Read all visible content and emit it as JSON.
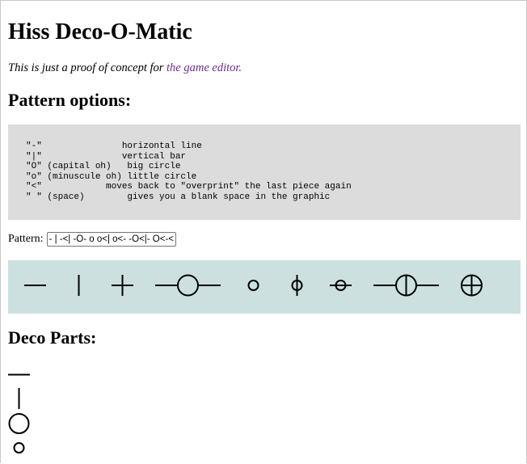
{
  "page": {
    "title": "Hiss Deco-O-Matic",
    "intro_text": "This is just a proof of concept for ",
    "intro_link": "the game editor.",
    "options_heading": "Pattern options:",
    "parts_heading": "Deco Parts:"
  },
  "pattern_options": [
    "\"-\"               horizontal line",
    "\"|\"               vertical bar",
    "\"O\" (capital oh)   big circle",
    "\"o\" (minuscule oh) little circle",
    "\"<\"            moves back to \"overprint\" the last piece again",
    "\" \" (space)        gives you a blank space in the graphic"
  ],
  "pattern": {
    "label": "Pattern:",
    "value": "- | -<| -O- o o<| o<- -O<|- O<-<|"
  },
  "deco_parts": [
    "horizontal-line",
    "vertical-bar",
    "big-circle",
    "little-circle"
  ]
}
